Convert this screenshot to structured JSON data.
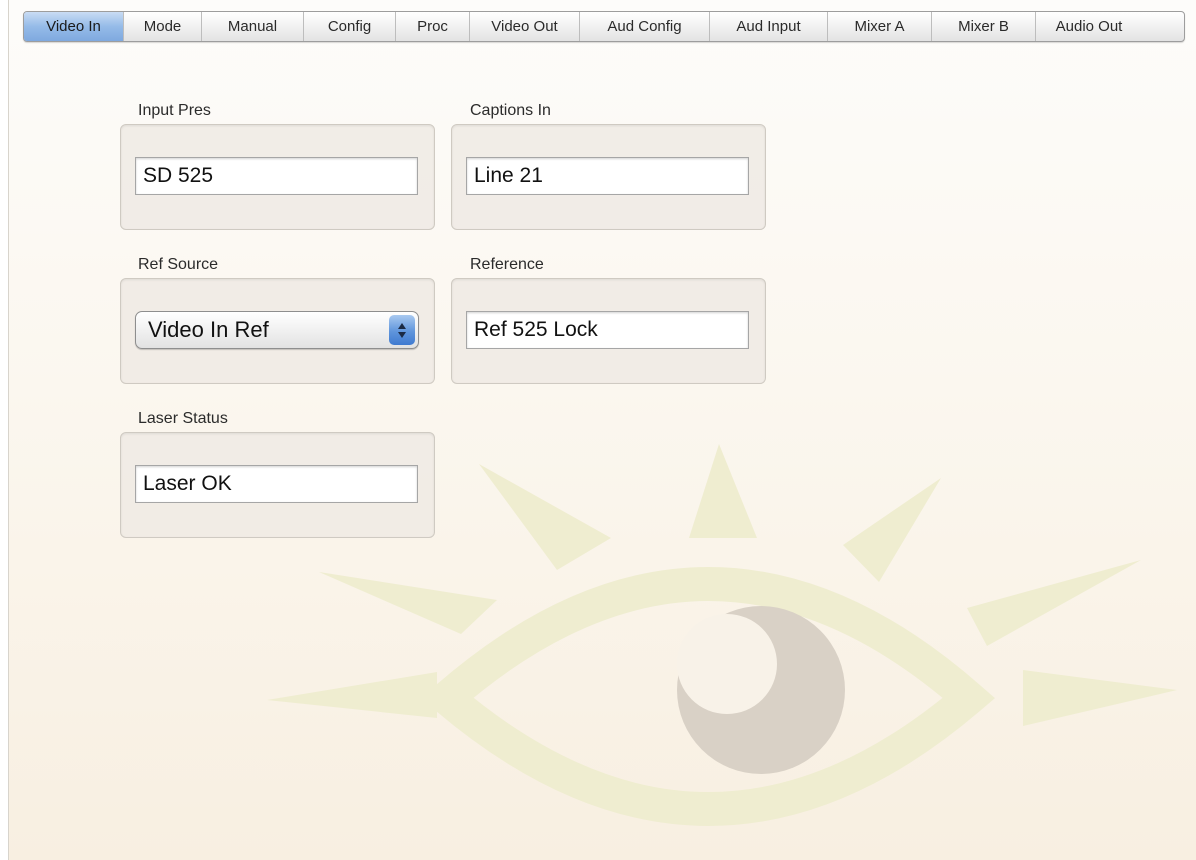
{
  "tabs": [
    {
      "label": "Video In",
      "active": true
    },
    {
      "label": "Mode",
      "active": false
    },
    {
      "label": "Manual",
      "active": false
    },
    {
      "label": "Config",
      "active": false
    },
    {
      "label": "Proc",
      "active": false
    },
    {
      "label": "Video Out",
      "active": false
    },
    {
      "label": "Aud Config",
      "active": false
    },
    {
      "label": "Aud Input",
      "active": false
    },
    {
      "label": "Mixer A",
      "active": false
    },
    {
      "label": "Mixer B",
      "active": false
    },
    {
      "label": "Audio Out",
      "active": false
    }
  ],
  "panels": {
    "input_pres": {
      "label": "Input Pres",
      "value": "SD 525"
    },
    "captions_in": {
      "label": "Captions In",
      "value": "Line 21"
    },
    "ref_source": {
      "label": "Ref Source",
      "value": "Video In Ref"
    },
    "reference": {
      "label": "Reference",
      "value": "Ref 525 Lock"
    },
    "laser_status": {
      "label": "Laser Status",
      "value": "Laser OK"
    }
  },
  "icons": {
    "select_arrows": "up-down-arrows-icon",
    "background_logo": "eye-sun-logo"
  },
  "colors": {
    "active_tab": "#95bbe8",
    "logo_rays": "#efedd0",
    "logo_iris": "#d8d0c4"
  }
}
